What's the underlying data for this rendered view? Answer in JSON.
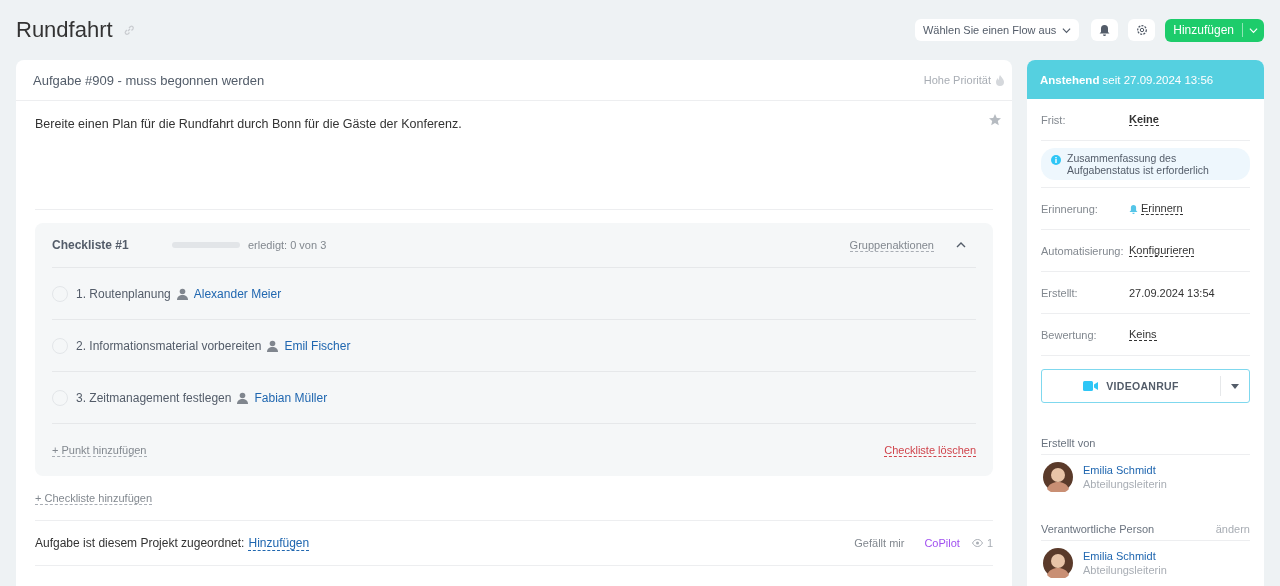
{
  "header": {
    "title": "Rundfahrt",
    "flow_select": "Wählen Sie einen Flow aus",
    "add_button": "Hinzufügen"
  },
  "task": {
    "heading": "Aufgabe #909 - muss begonnen werden",
    "priority": "Hohe Priorität",
    "starred": false,
    "description": "Bereite einen Plan für die Rundfahrt durch Bonn für die Gäste der Konferenz.",
    "checklist": {
      "title": "Checkliste #1",
      "level": 0,
      "progress": "erledigt: 0 von 3",
      "group_actions": "Gruppenaktionen",
      "expanded": true,
      "items": [
        {
          "number": "1.",
          "text": "Routenplanung",
          "person": "Alexander Meier",
          "checked": false
        },
        {
          "number": "2.",
          "text": "Informationsmaterial vorbereiten",
          "person": "Emil Fischer",
          "checked": false
        },
        {
          "number": "3.",
          "text": "Zeitmanagement festlegen",
          "person": "Fabian Müller",
          "checked": false
        }
      ],
      "add_item": "+ Punkt hinzufügen",
      "delete": "Checkliste löschen"
    },
    "add_checklist": "+ Checkliste hinzufügen",
    "project_label": "Aufgabe ist diesem Projekt zugeordnet:",
    "project_link": "Hinzufügen",
    "like": "Gefällt mir",
    "copilot": "CoPilot",
    "views": "1"
  },
  "sidebar": {
    "status": "Anstehend",
    "status_since": "seit 27.09.2024 13:56",
    "fields": [
      {
        "kind": "link",
        "label": "Frist:",
        "value": "Keine"
      },
      {
        "kind": "notice",
        "value": "Zusammenfassung des Aufgabenstatus ist erforderlich"
      },
      {
        "kind": "reminder",
        "label": "Erinnerung:",
        "value": "Erinnern"
      },
      {
        "kind": "link",
        "label": "Automatisierung:",
        "value": "Konfigurieren"
      },
      {
        "kind": "text",
        "label": "Erstellt:",
        "value": "27.09.2024 13:54"
      },
      {
        "kind": "link",
        "label": "Bewertung:",
        "value": "Keins"
      }
    ],
    "video_button": "VIDEOANRUF",
    "people": [
      {
        "heading": "Erstellt von",
        "name": "Emilia Schmidt",
        "role": "Abteilungsleiterin"
      },
      {
        "heading": "Verantwortliche Person",
        "action": "ändern",
        "name": "Emilia Schmidt",
        "role": "Abteilungsleiterin"
      }
    ]
  }
}
